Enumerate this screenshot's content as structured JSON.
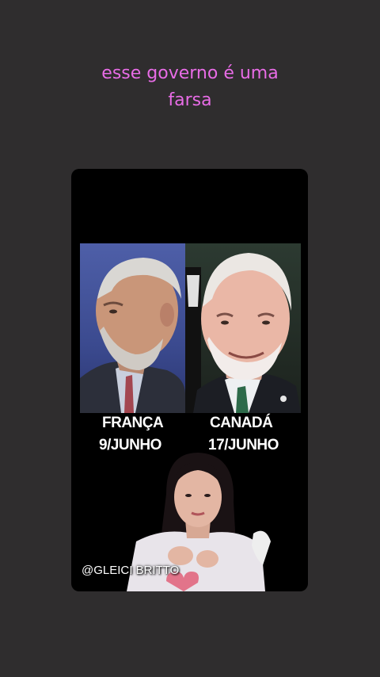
{
  "caption": {
    "line1": "esse governo é uma",
    "line2": "farsa"
  },
  "video": {
    "left_photo": {
      "country": "FRANÇA",
      "date": "9/JUNHO"
    },
    "right_photo": {
      "country": "CANADÁ",
      "date": "17/JUNHO"
    },
    "watermark": "@GLEICI BRITTO"
  },
  "colors": {
    "background": "#2f2d2e",
    "caption": "#e86ce6",
    "card": "#000000"
  }
}
